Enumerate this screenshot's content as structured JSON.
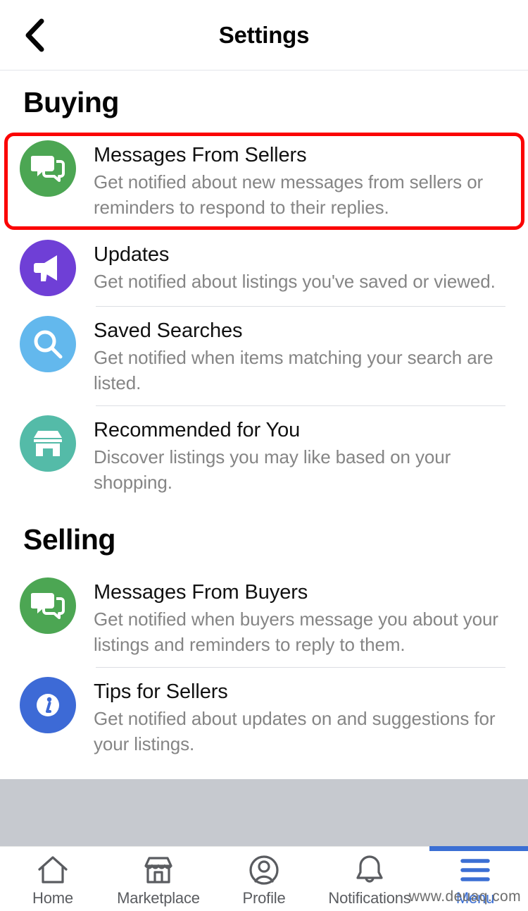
{
  "header": {
    "title": "Settings",
    "back_icon": "chevron-left-icon"
  },
  "sections": [
    {
      "heading": "Buying",
      "items": [
        {
          "title": "Messages From Sellers",
          "description": "Get notified about new messages from sellers or reminders to respond to their replies.",
          "icon": "chat-bubbles-icon",
          "icon_color": "#4CA653",
          "highlighted": true
        },
        {
          "title": "Updates",
          "description": "Get notified about listings you've saved or viewed.",
          "icon": "megaphone-icon",
          "icon_color": "#6F3FD6"
        },
        {
          "title": "Saved Searches",
          "description": "Get notified when items matching your search are listed.",
          "icon": "magnifier-icon",
          "icon_color": "#63B8ED"
        },
        {
          "title": "Recommended for You",
          "description": "Discover listings you may like based on your shopping.",
          "icon": "storefront-icon",
          "icon_color": "#54BBA8"
        }
      ]
    },
    {
      "heading": "Selling",
      "items": [
        {
          "title": "Messages From Buyers",
          "description": "Get notified when buyers message you about your listings and reminders to reply to them.",
          "icon": "chat-bubbles-icon",
          "icon_color": "#4CA653"
        },
        {
          "title": "Tips for Sellers",
          "description": "Get notified about updates on and suggestions for your listings.",
          "icon": "info-circle-icon",
          "icon_color": "#3D6AD6"
        }
      ]
    }
  ],
  "bottom_nav": {
    "active_index": 4,
    "active_color": "#3b6fd4",
    "tabs": [
      {
        "label": "Home",
        "icon": "home-icon"
      },
      {
        "label": "Marketplace",
        "icon": "storefront-outline-icon"
      },
      {
        "label": "Profile",
        "icon": "user-circle-icon"
      },
      {
        "label": "Notifications",
        "icon": "bell-icon"
      },
      {
        "label": "Menu",
        "icon": "hamburger-menu-icon"
      }
    ]
  },
  "watermark": "www.deuaq.com",
  "highlight": {
    "color": "#fb0303"
  }
}
